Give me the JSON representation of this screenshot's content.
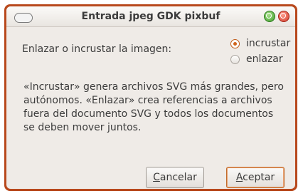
{
  "window": {
    "title": "Entrada jpeg GDK pixbuf"
  },
  "form": {
    "question_label": "Enlazar o incrustar la imagen:",
    "options": [
      {
        "label": "incrustar",
        "selected": true
      },
      {
        "label": "enlazar",
        "selected": false
      }
    ]
  },
  "description": "«Incrustar» genera archivos SVG más grandes, pero autónomos. «Enlazar» crea referencias a archivos fuera del documento SVG y todos los documentos se deben mover juntos.",
  "buttons": {
    "cancel_mnemonic": "C",
    "cancel_rest": "ancelar",
    "accept_mnemonic": "A",
    "accept_rest": "ceptar"
  },
  "colors": {
    "frame": "#b8481c",
    "radio_selected": "#d0641c",
    "window_bg": "#efebe7"
  }
}
